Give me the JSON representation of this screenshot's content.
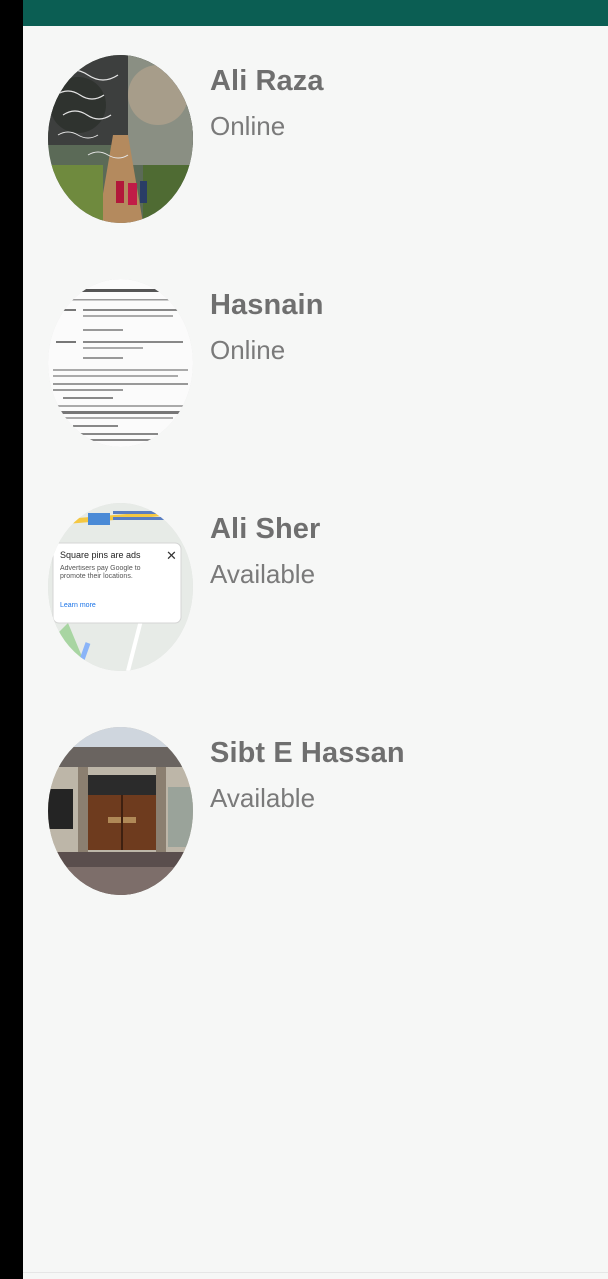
{
  "theme": {
    "app_bar_color": "#0b5e53",
    "background": "#f6f7f6",
    "name_color": "#6f6f6f",
    "status_color": "#7a7a7a"
  },
  "contacts": [
    {
      "name": "Ali Raza",
      "status": "Online",
      "avatar": "scenic-path-photo"
    },
    {
      "name": "Hasnain",
      "status": "Online",
      "avatar": "document-photo"
    },
    {
      "name": "Ali Sher",
      "status": "Available",
      "avatar": "map-screenshot"
    },
    {
      "name": "Sibt E Hassan",
      "status": "Available",
      "avatar": "house-gate-photo"
    }
  ],
  "avatar_texts": {
    "map_popup_title": "Square pins are ads",
    "map_popup_body": "Advertisers pay Google to promote their locations.",
    "map_popup_link": "Learn more"
  }
}
